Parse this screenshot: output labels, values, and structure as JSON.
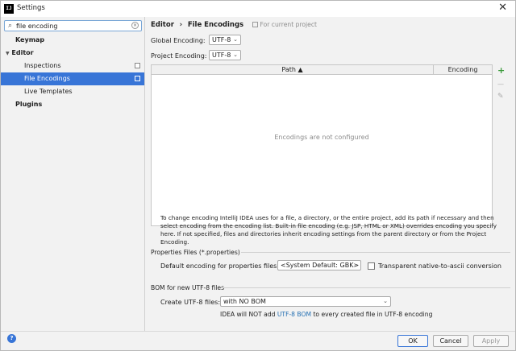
{
  "window": {
    "title": "Settings",
    "app_icon": "IJ"
  },
  "search": {
    "value": "file encoding",
    "placeholder": ""
  },
  "sidebar": {
    "items": [
      {
        "label": "Keymap"
      },
      {
        "label": "Editor"
      },
      {
        "label": "Inspections"
      },
      {
        "label": "File Encodings"
      },
      {
        "label": "Live Templates"
      },
      {
        "label": "Plugins"
      }
    ]
  },
  "breadcrumb": {
    "parent": "Editor",
    "separator": "›",
    "current": "File Encodings",
    "scope_note": "For current project"
  },
  "global_encoding": {
    "label": "Global Encoding:",
    "value": "UTF-8"
  },
  "project_encoding": {
    "label": "Project Encoding:",
    "value": "UTF-8"
  },
  "table": {
    "columns": [
      "Path ▲",
      "Encoding"
    ],
    "empty_text": "Encodings are not configured"
  },
  "toolbar": {
    "add": "+",
    "remove": "—",
    "edit": "✎"
  },
  "description": "To change encoding IntelliJ IDEA uses for a file, a directory, or the entire project, add its path if necessary and then select encoding from the encoding list. Built-in file encoding (e.g. JSP, HTML or XML) overrides encoding you specify here. If not specified, files and directories inherit encoding settings from the parent directory or from the Project Encoding.",
  "properties_files": {
    "header": "Properties Files (*.properties)",
    "default_label": "Default encoding for properties files:",
    "default_value": "<System Default: GBK>",
    "transparent_label": "Transparent native-to-ascii conversion"
  },
  "bom": {
    "header": "BOM for new UTF-8 files",
    "create_label": "Create UTF-8 files:",
    "create_value": "with NO BOM",
    "note_prefix": "IDEA will NOT add ",
    "note_link": "UTF-8 BOM",
    "note_suffix": " to every created file in UTF-8 encoding"
  },
  "buttons": {
    "ok": "OK",
    "cancel": "Cancel",
    "apply": "Apply"
  },
  "colors": {
    "accent": "#3875d7",
    "link": "#2470b3"
  }
}
